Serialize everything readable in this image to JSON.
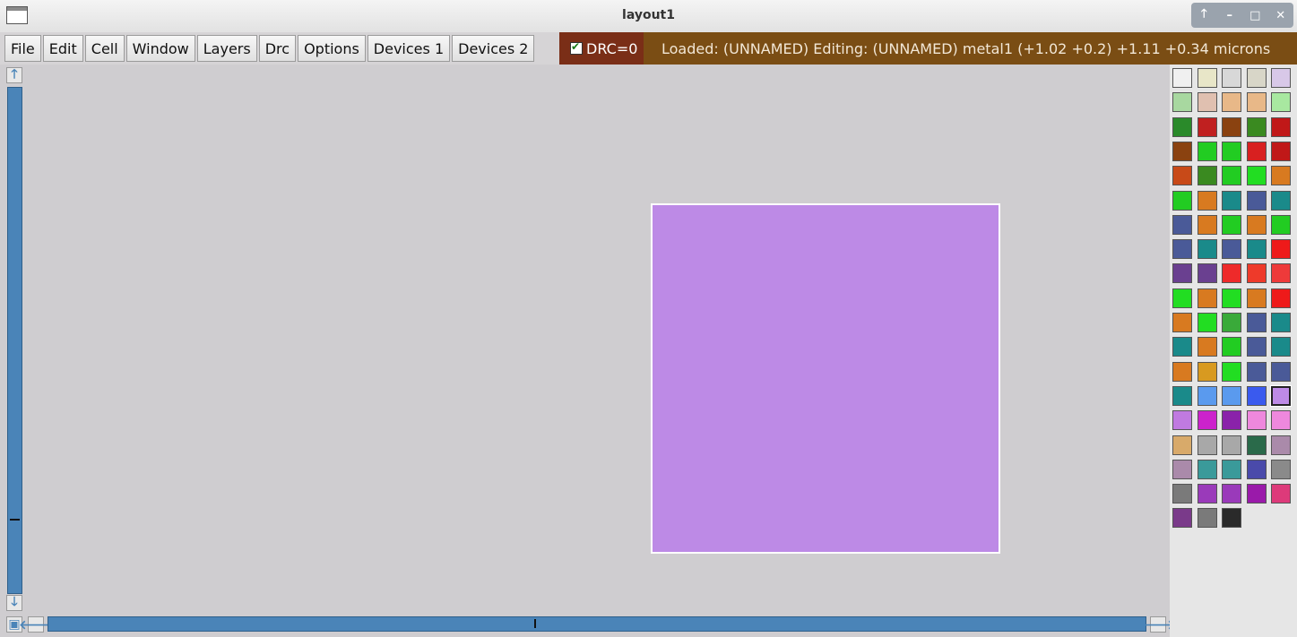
{
  "window": {
    "title": "layout1",
    "buttons": [
      "🡑",
      "–",
      "□",
      "✕"
    ]
  },
  "menu": [
    {
      "label": "File"
    },
    {
      "label": "Edit"
    },
    {
      "label": "Cell"
    },
    {
      "label": "Window"
    },
    {
      "label": "Layers"
    },
    {
      "label": "Drc"
    },
    {
      "label": "Options"
    },
    {
      "label": "Devices 1"
    },
    {
      "label": "Devices 2"
    }
  ],
  "drc": {
    "label": "DRC=0",
    "checked": true
  },
  "status": {
    "text": "Loaded: (UNNAMED) Editing: (UNNAMED) metal1   (+1.02 +0.2) +1.11 +0.34 microns"
  },
  "canvas": {
    "shape_layer": "metal1",
    "shape_color": "#bd8ae6"
  },
  "scroll": {
    "up": "🡑",
    "down": "🡓",
    "left": "🡐",
    "right": "🡒",
    "fit": "▣"
  },
  "palette": {
    "colors": [
      [
        "#f0f0f0",
        "#e8e6c8",
        "#d8d8d8",
        "#d8d6c8",
        "#d8c8e8"
      ],
      [
        "#a8d8a0",
        "#e0c0b0",
        "#e8b888",
        "#e8b888",
        "#a8e8a0"
      ],
      [
        "#2a8a2a",
        "#c02020",
        "#8a4210",
        "#3a8a20",
        "#c01818"
      ],
      [
        "#8a4210",
        "#22cc22",
        "#22cc22",
        "#d82020",
        "#c01818"
      ],
      [
        "#c84a18",
        "#3a8a20",
        "#22cc22",
        "#22dd22",
        "#d87a20"
      ],
      [
        "#22cc22",
        "#d87a20",
        "#1a8a8a",
        "#4a5a98",
        "#1a8a8a"
      ],
      [
        "#4a5a98",
        "#d87a20",
        "#22cc22",
        "#d87a20",
        "#22cc22"
      ],
      [
        "#4a5a98",
        "#1a8a8a",
        "#4a5a98",
        "#1a8a8a",
        "#ee1a1a"
      ],
      [
        "#6a4090",
        "#6a4090",
        "#ee2a2a",
        "#ee3a2a",
        "#ee3a3a"
      ],
      [
        "#22dd22",
        "#d87a20",
        "#22dd22",
        "#d87a20",
        "#ee1a1a"
      ],
      [
        "#d87a20",
        "#22dd22",
        "#3aaa3a",
        "#4a5a98",
        "#1a8a8a"
      ],
      [
        "#1a8a8a",
        "#d87a20",
        "#22cc22",
        "#4a5a98",
        "#1a8a8a"
      ],
      [
        "#d87a20",
        "#d89a20",
        "#22dd22",
        "#4a5a98",
        "#4a5a98"
      ],
      [
        "#1a8a8a",
        "#5a9aee",
        "#5a9aee",
        "#3a5aee",
        "#bd8ae6"
      ],
      [
        "#c07ae0",
        "#cc22cc",
        "#8a22aa",
        "#ee88dd",
        "#ee88dd"
      ],
      [
        "#d8aa6a",
        "#a8a8a8",
        "#a8a8a8",
        "#2a6a4a",
        "#aa8aaa"
      ],
      [
        "#aa8aaa",
        "#3a9a9a",
        "#3a9a9a",
        "#4a4aaa",
        "#8a8a8a"
      ],
      [
        "#7a7a7a",
        "#9a3aba",
        "#9a3aba",
        "#9a1aaa",
        "#dd3a7a"
      ],
      [
        "#7a3a8a",
        "#7a7a7a",
        "#2a2a2a"
      ]
    ],
    "selected": [
      13,
      4
    ]
  }
}
